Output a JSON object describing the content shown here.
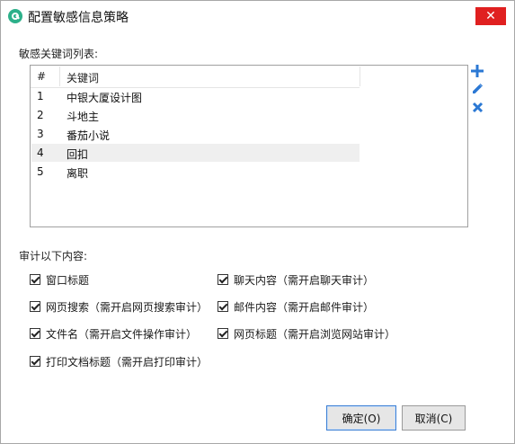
{
  "window": {
    "title": "配置敏感信息策略",
    "close_label": "✕"
  },
  "keywords": {
    "section_label": "敏感关键词列表:",
    "columns": [
      "#",
      "关键词"
    ],
    "rows": [
      {
        "num": "1",
        "keyword": "中银大厦设计图"
      },
      {
        "num": "2",
        "keyword": "斗地主"
      },
      {
        "num": "3",
        "keyword": "番茄小说"
      },
      {
        "num": "4",
        "keyword": "回扣",
        "selected": true
      },
      {
        "num": "5",
        "keyword": "离职"
      }
    ],
    "actions": [
      "add-icon",
      "edit-icon",
      "delete-icon"
    ],
    "accent": "#2b78d4"
  },
  "audit": {
    "section_label": "审计以下内容:",
    "options": [
      {
        "label": "窗口标题",
        "checked": true
      },
      {
        "label": "聊天内容（需开启聊天审计）",
        "checked": true
      },
      {
        "label": "网页搜索（需开启网页搜索审计）",
        "checked": true
      },
      {
        "label": "邮件内容（需开启邮件审计）",
        "checked": true
      },
      {
        "label": "文件名（需开启文件操作审计）",
        "checked": true
      },
      {
        "label": "网页标题（需开启浏览网站审计）",
        "checked": true
      },
      {
        "label": "打印文档标题（需开启打印审计）",
        "checked": true
      }
    ]
  },
  "buttons": {
    "ok_label": "确定(O)",
    "cancel_label": "取消(C)"
  }
}
